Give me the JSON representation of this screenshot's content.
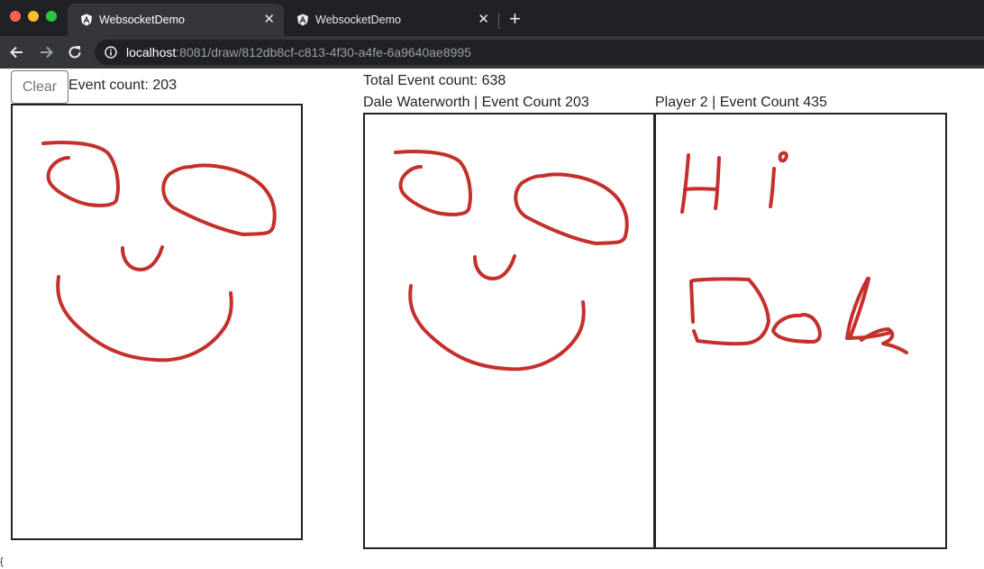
{
  "browser": {
    "tabs": [
      {
        "title": "WebsocketDemo",
        "active": true
      },
      {
        "title": "WebsocketDemo",
        "active": false
      }
    ],
    "url_host": "localhost",
    "url_path": ":8081/draw/812db8cf-c813-4f30-a4fe-6a9640ae8995"
  },
  "controls": {
    "clear_label": "Clear",
    "local_event_count": "Event count: 203"
  },
  "summary": {
    "total_event_count": "Total Event count: 638"
  },
  "players": [
    {
      "label": "Dale Waterworth | Event Count 203"
    },
    {
      "label": "Player 2 | Event Count 435"
    }
  ],
  "stroke_color": "#c4302b",
  "footer_text": "{"
}
